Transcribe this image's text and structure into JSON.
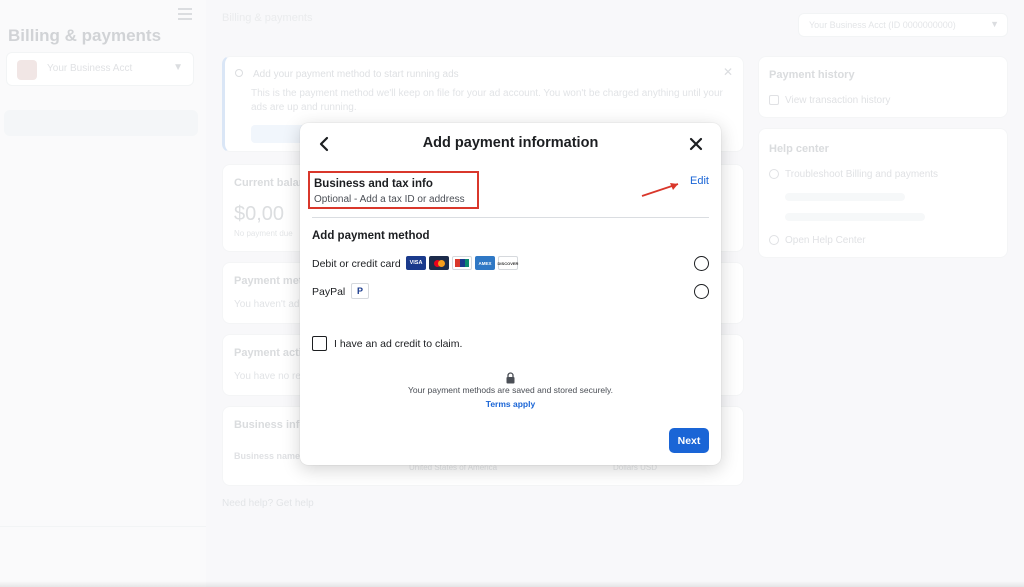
{
  "sidebar": {
    "title": "Billing & payments",
    "account_name": "Your Business Acct"
  },
  "topbar": {
    "crumb": "Billing & payments",
    "account_selector": "Your Business Acct (ID 0000000000)"
  },
  "banner": {
    "title": "Add your payment method to start running ads",
    "body": "This is the payment method we'll keep on file for your ad account. You won't be charged anything until your ads are up and running."
  },
  "balance": {
    "label": "Current balance",
    "amount": "$0,00",
    "note": "No payment due"
  },
  "payment_methods_card": {
    "label": "Payment methods",
    "note": "You haven't added any payment methods."
  },
  "payment_activity_card": {
    "label": "Payment activity",
    "note": "You have no recent activity."
  },
  "business_info_card": {
    "label": "Business info",
    "business_name_label": "Business name",
    "country": "United States of America",
    "currency": "Dollars USD"
  },
  "need_help": {
    "prefix": "Need help?",
    "link": "Get help"
  },
  "payment_history": {
    "title": "Payment history",
    "link": "View transaction history"
  },
  "help_center": {
    "title": "Help center",
    "link1": "Troubleshoot Billing and payments",
    "link4": "Open Help Center"
  },
  "modal": {
    "title": "Add payment information",
    "business_tax": {
      "title": "Business and tax info",
      "subtitle": "Optional - Add a tax ID or address",
      "edit_label": "Edit"
    },
    "payment_section_title": "Add payment method",
    "options": {
      "card_label": "Debit or credit card",
      "paypal_label": "PayPal",
      "card_brands": [
        "VISA",
        "",
        "",
        "AMEX",
        "DISCOVER"
      ]
    },
    "credit_label": "I have an ad credit to claim.",
    "secure_text": "Your payment methods are saved and stored securely.",
    "terms_label": "Terms apply",
    "next_label": "Next"
  },
  "colors": {
    "primary": "#1a65d6",
    "highlight_red": "#d9372b",
    "text": "#1c1e21"
  }
}
